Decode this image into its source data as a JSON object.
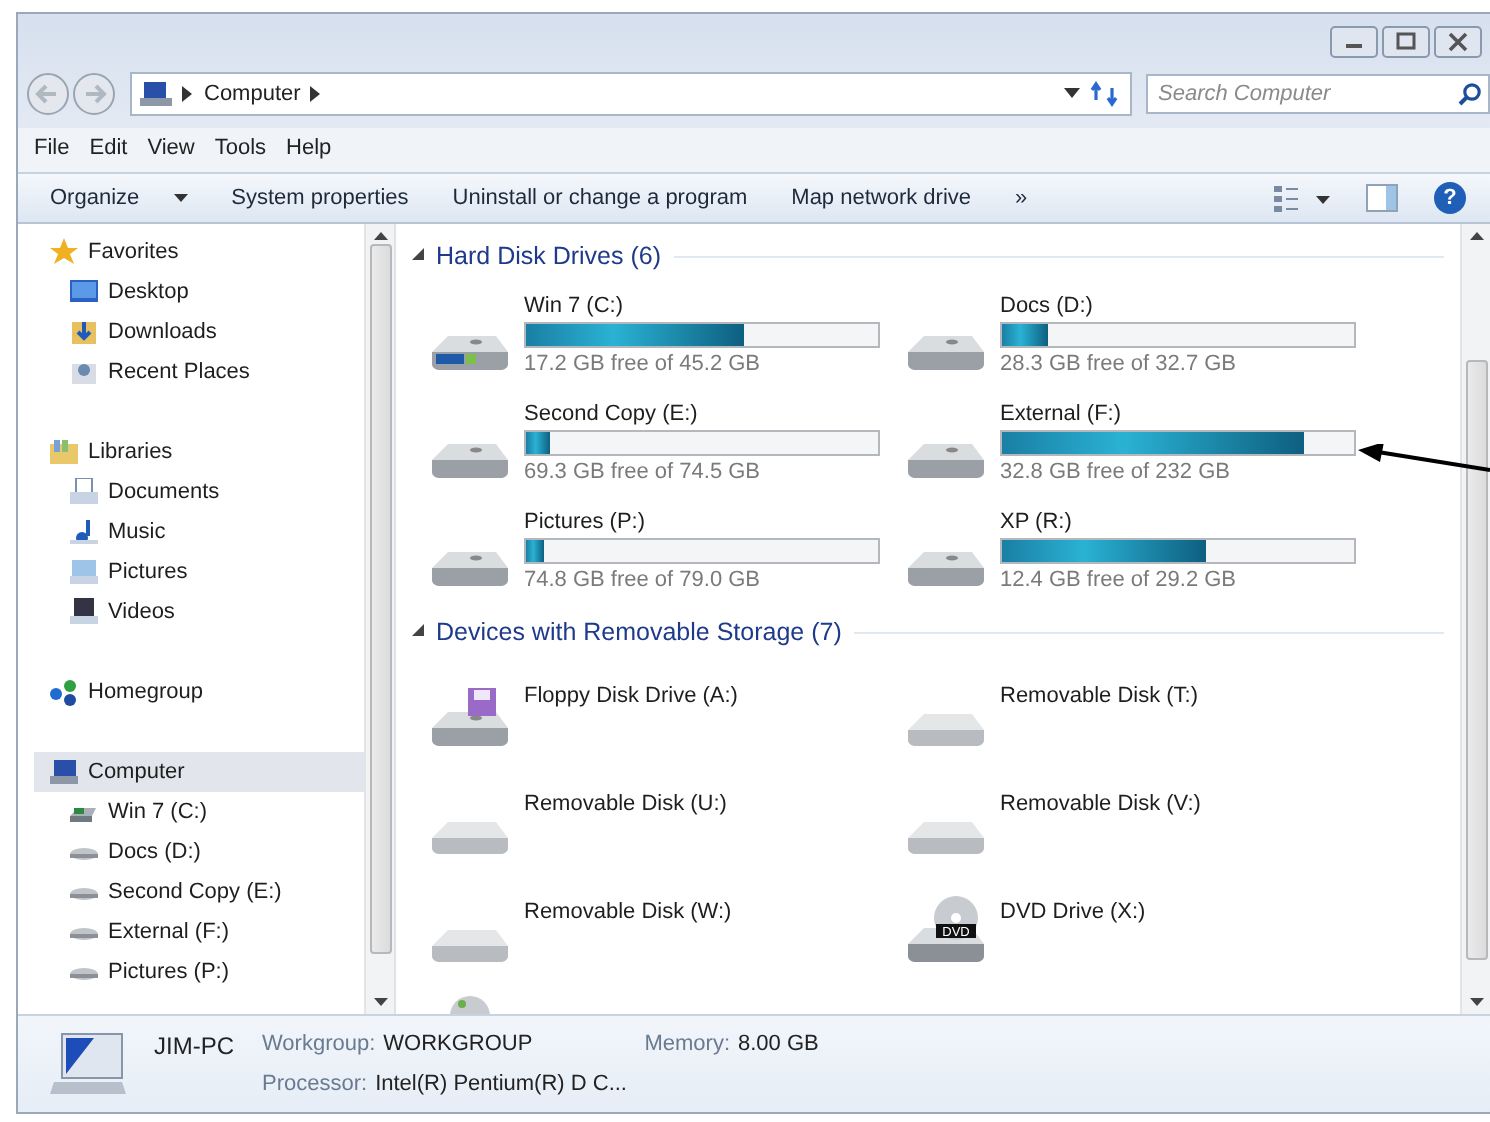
{
  "address_bar": {
    "path": [
      "Computer"
    ],
    "search_placeholder": "Search Computer"
  },
  "menu": [
    "File",
    "Edit",
    "View",
    "Tools",
    "Help"
  ],
  "toolbar": [
    {
      "label": "Organize",
      "kind": "dropdown"
    },
    {
      "label": "System properties",
      "kind": "button"
    },
    {
      "label": "Uninstall or change a program",
      "kind": "button"
    },
    {
      "label": "Map network drive",
      "kind": "button"
    },
    {
      "label": "»",
      "kind": "more"
    },
    {
      "label": "?",
      "kind": "help"
    }
  ],
  "sidebar": {
    "groups": [
      {
        "label": "Favorites",
        "kind": "star",
        "selected": false,
        "children": [
          {
            "label": "Desktop",
            "kind": "desktop",
            "selected": false
          },
          {
            "label": "Downloads",
            "kind": "downloads",
            "selected": false
          },
          {
            "label": "Recent Places",
            "kind": "recent",
            "selected": false
          }
        ]
      },
      {
        "label": "Libraries",
        "kind": "library",
        "selected": false,
        "children": [
          {
            "label": "Documents",
            "kind": "documents",
            "selected": false
          },
          {
            "label": "Music",
            "kind": "music",
            "selected": false
          },
          {
            "label": "Pictures",
            "kind": "pictures",
            "selected": false
          },
          {
            "label": "Videos",
            "kind": "videos",
            "selected": false
          }
        ]
      },
      {
        "label": "Homegroup",
        "kind": "homegroup",
        "selected": false
      },
      {
        "label": "Computer",
        "kind": "computer",
        "selected": true,
        "children": [
          {
            "label": "Win 7 (C:)",
            "kind": "system",
            "selected": false
          },
          {
            "label": "Docs (D:)",
            "kind": "drive",
            "selected": false
          },
          {
            "label": "Second Copy (E:)",
            "kind": "drive",
            "selected": false
          },
          {
            "label": "External (F:)",
            "kind": "drive",
            "selected": false
          },
          {
            "label": "Pictures (P:)",
            "kind": "drive",
            "selected": false
          }
        ]
      }
    ]
  },
  "sections": [
    {
      "title": "Hard Disk Drives (6)",
      "expanded": true,
      "items": [
        {
          "name": "Win 7 (C:)",
          "kind": "system",
          "level": 0.62,
          "free": "17.2 GB free of 45.2 GB"
        },
        {
          "name": "Docs (D:)",
          "kind": "hdd",
          "level": 0.13,
          "free": "28.3 GB free of 32.7 GB"
        },
        {
          "name": "Second Copy (E:)",
          "kind": "hdd",
          "level": 0.07,
          "free": "69.3 GB free of 74.5 GB"
        },
        {
          "name": "External (F:)",
          "kind": "hdd",
          "level": 0.86,
          "free": "32.8 GB free of 232 GB"
        },
        {
          "name": "Pictures (P:)",
          "kind": "hdd",
          "level": 0.05,
          "free": "74.8 GB free of 79.0 GB"
        },
        {
          "name": "XP (R:)",
          "kind": "hdd",
          "level": 0.58,
          "free": "12.4 GB free of 29.2 GB"
        }
      ]
    },
    {
      "title": "Devices with Removable Storage (7)",
      "expanded": true,
      "items": [
        {
          "name": "Floppy Disk Drive (A:)",
          "kind": "floppy"
        },
        {
          "name": "Removable Disk (T:)",
          "kind": "removable"
        },
        {
          "name": "Removable Disk (U:)",
          "kind": "removable"
        },
        {
          "name": "Removable Disk (V:)",
          "kind": "removable"
        },
        {
          "name": "Removable Disk (W:)",
          "kind": "removable"
        },
        {
          "name": "DVD Drive (X:)",
          "kind": "dvd",
          "icon_label": "DVD"
        },
        {
          "kind": "cd"
        }
      ]
    }
  ],
  "details": {
    "name": "JIM-PC",
    "fields": [
      {
        "label": "Workgroup:",
        "value": "WORKGROUP"
      },
      {
        "label": "Memory:",
        "value": "8.00 GB"
      },
      {
        "label": "Processor:",
        "value": "Intel(R) Pentium(R) D C..."
      }
    ]
  }
}
